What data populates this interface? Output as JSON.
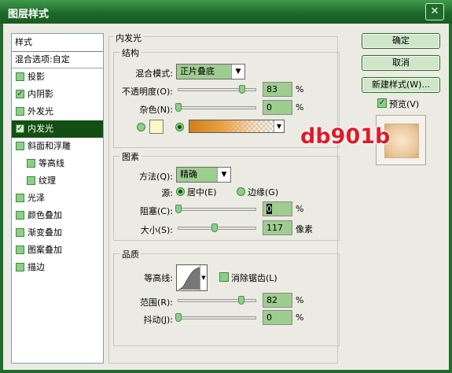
{
  "window": {
    "title": "图层样式",
    "close_glyph": "✕"
  },
  "style_list": {
    "header": "样式",
    "blend_options": "混合选项:自定",
    "items": [
      {
        "label": "投影",
        "checked": false
      },
      {
        "label": "内阴影",
        "checked": true
      },
      {
        "label": "外发光",
        "checked": false
      },
      {
        "label": "内发光",
        "checked": true,
        "selected": true
      },
      {
        "label": "斜面和浮雕",
        "checked": false
      },
      {
        "label": "等高线",
        "checked": false,
        "sub": true
      },
      {
        "label": "纹理",
        "checked": false,
        "sub": true
      },
      {
        "label": "光泽",
        "checked": false
      },
      {
        "label": "颜色叠加",
        "checked": false
      },
      {
        "label": "渐变叠加",
        "checked": false
      },
      {
        "label": "图案叠加",
        "checked": false
      },
      {
        "label": "描边",
        "checked": false
      }
    ],
    "check_glyph": "✓"
  },
  "inner_glow": {
    "title": "内发光",
    "structure": {
      "title": "结构",
      "blend_mode_label": "混合模式:",
      "blend_mode_value": "正片叠底",
      "opacity_label": "不透明度(O):",
      "opacity_value": "83",
      "opacity_fraction": 0.83,
      "noise_label": "杂色(N):",
      "noise_value": "0",
      "noise_fraction": 0.0,
      "unit": "%",
      "swatch_color": "#fdf8c6"
    },
    "elements": {
      "title": "图素",
      "method_label": "方法(Q):",
      "method_value": "精确",
      "source_label": "源:",
      "source_center": "居中(E)",
      "source_edge": "边缘(G)",
      "choke_label": "阻塞(C):",
      "choke_value": "0",
      "choke_fraction": 0.0,
      "size_label": "大小(S):",
      "size_value": "117",
      "size_fraction": 0.47,
      "size_unit": "像素"
    },
    "quality": {
      "title": "品质",
      "contour_label": "等高线:",
      "antialias_label": "消除锯齿(L)",
      "range_label": "范围(R):",
      "range_value": "82",
      "range_fraction": 0.82,
      "jitter_label": "抖动(J):",
      "jitter_value": "0",
      "jitter_fraction": 0.0
    }
  },
  "buttons": {
    "ok": "确定",
    "cancel": "取消",
    "new_style": "新建样式(W)...",
    "preview_label": "预览(V)"
  },
  "watermark": "db901b",
  "colors": {
    "accent_green": "#134f12",
    "title_bar": "#1d6b29",
    "field_green": "#9ecd90",
    "watermark_red": "#e01a2a"
  }
}
